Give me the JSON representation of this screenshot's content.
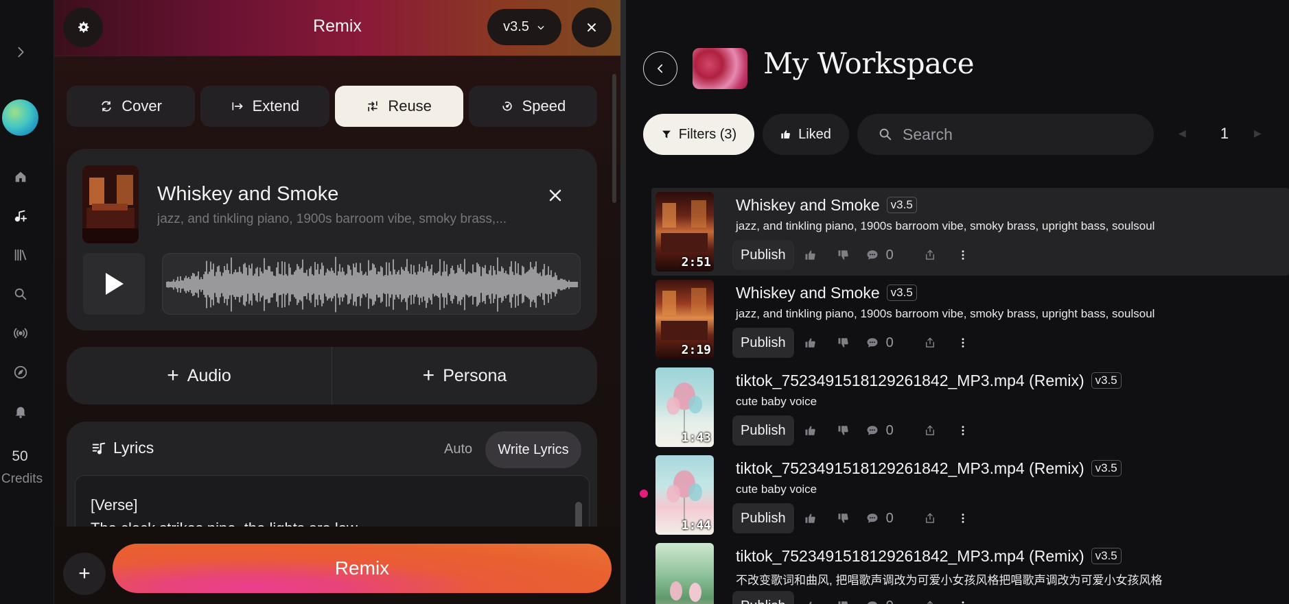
{
  "nav": {
    "items": [
      "expand-icon",
      "home-icon",
      "create-icon",
      "library-icon",
      "search-icon",
      "radio-icon",
      "explore-icon",
      "bell-icon"
    ],
    "credits_value": "50",
    "credits_label": "Credits"
  },
  "panel": {
    "title": "Remix",
    "version": "v3.5",
    "tabs": [
      {
        "label": "Cover",
        "icon": "cover-icon"
      },
      {
        "label": "Extend",
        "icon": "extend-icon"
      },
      {
        "label": "Reuse",
        "icon": "reuse-icon",
        "active": true
      },
      {
        "label": "Speed",
        "icon": "speed-icon"
      }
    ],
    "track": {
      "title": "Whiskey and Smoke",
      "description": "jazz, and tinkling piano, 1900s barroom vibe, smoky brass,..."
    },
    "add_audio": "Audio",
    "add_persona": "Persona",
    "lyrics": {
      "heading": "Lyrics",
      "auto": "Auto",
      "write": "Write Lyrics",
      "text": "[Verse]\nThe clock strikes nine, the lights are low"
    },
    "remix_button": "Remix"
  },
  "workspace": {
    "title": "My Workspace",
    "filters": "Filters (3)",
    "liked": "Liked",
    "search_placeholder": "Search",
    "page": "1",
    "publish_label": "Publish",
    "songs": [
      {
        "title": "Whiskey and Smoke",
        "version": "v3.5",
        "desc": "jazz, and tinkling piano, 1900s barroom vibe, smoky brass, upright bass, soulsoul",
        "duration": "2:51",
        "comments": "0"
      },
      {
        "title": "Whiskey and Smoke",
        "version": "v3.5",
        "desc": "jazz, and tinkling piano, 1900s barroom vibe, smoky brass, upright bass, soulsoul",
        "duration": "2:19",
        "comments": "0"
      },
      {
        "title": "tiktok_7523491518129261842_MP3.mp4 (Remix)",
        "version": "v3.5",
        "desc": "cute baby voice",
        "duration": "1:43",
        "comments": "0"
      },
      {
        "title": "tiktok_7523491518129261842_MP3.mp4 (Remix)",
        "version": "v3.5",
        "desc": "cute baby voice",
        "duration": "1:44",
        "comments": "0"
      },
      {
        "title": "tiktok_7523491518129261842_MP3.mp4 (Remix)",
        "version": "v3.5",
        "desc": "不改变歌词和曲风, 把唱歌声调改为可爱小女孩风格把唱歌声调改为可爱小女孩风格",
        "duration": "",
        "comments": "0"
      }
    ]
  },
  "colors": {
    "accent_remix": "#e8612f",
    "accent_pink": "#e41d7a",
    "active_tab_bg": "#f4efe6"
  }
}
